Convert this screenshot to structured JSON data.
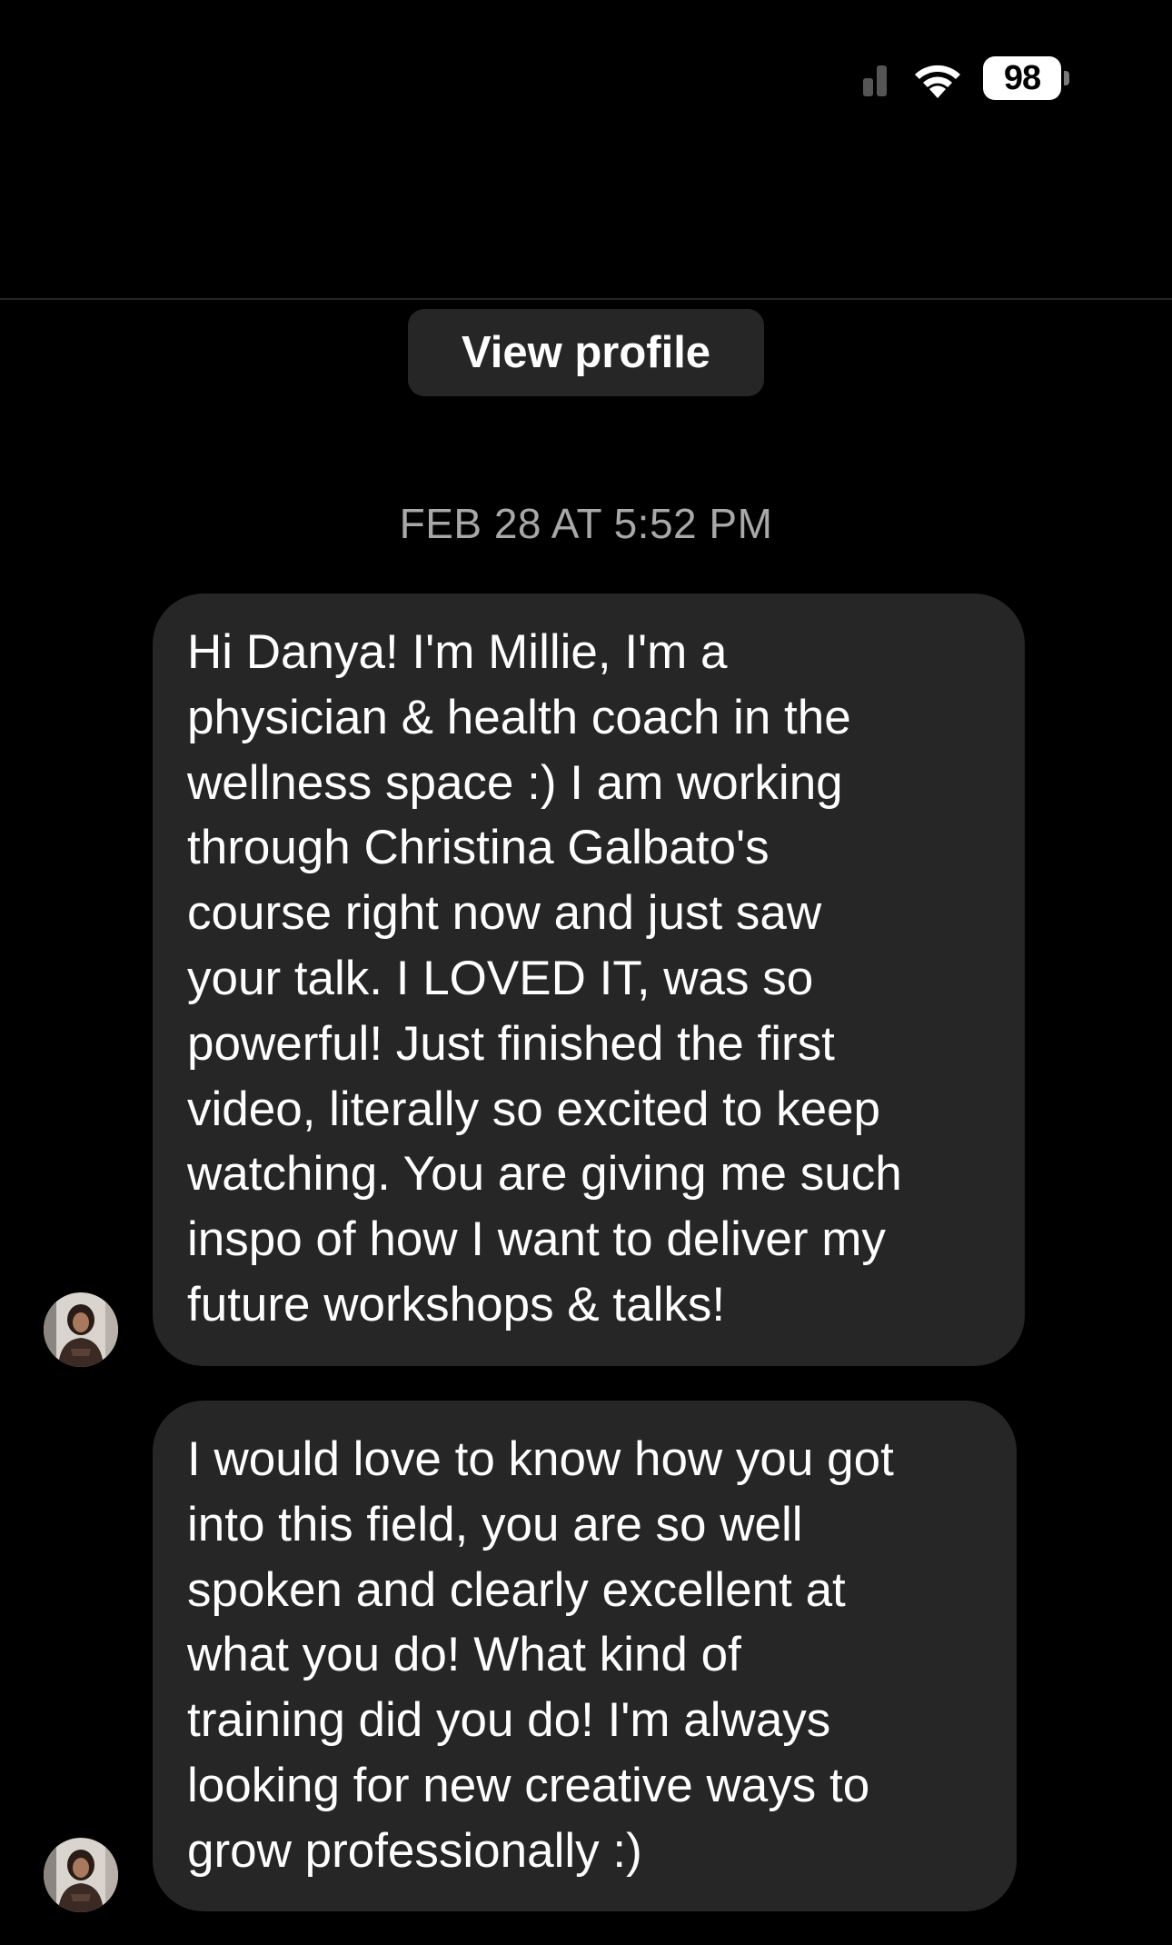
{
  "status_bar": {
    "battery_level": "98",
    "icons": [
      "cellular-signal-icon",
      "wifi-icon",
      "battery-icon"
    ]
  },
  "thread": {
    "view_profile_label": "View profile",
    "timestamp": "FEB 28 AT 5:52 PM"
  },
  "messages": [
    {
      "sender": "incoming",
      "text": "Hi Danya! I'm Millie, I'm a\nphysician & health coach in the\nwellness space :) I am working\nthrough Christina Galbato's\ncourse right now and just saw\nyour talk. I LOVED IT, was so\npowerful! Just finished the first\nvideo, literally so excited to keep\nwatching. You are giving me such\ninspo of how I want to deliver my\nfuture workshops & talks!"
    },
    {
      "sender": "incoming",
      "text": "I would love to know how you got\ninto this field, you are so well\nspoken and clearly excellent at\nwhat you do! What kind of\ntraining did you do! I'm always\nlooking for new creative ways to\ngrow professionally :)"
    }
  ],
  "colors": {
    "background": "#000000",
    "bubble": "#262626",
    "timestamp_text": "#a8a8a8",
    "text": "#ffffff"
  }
}
